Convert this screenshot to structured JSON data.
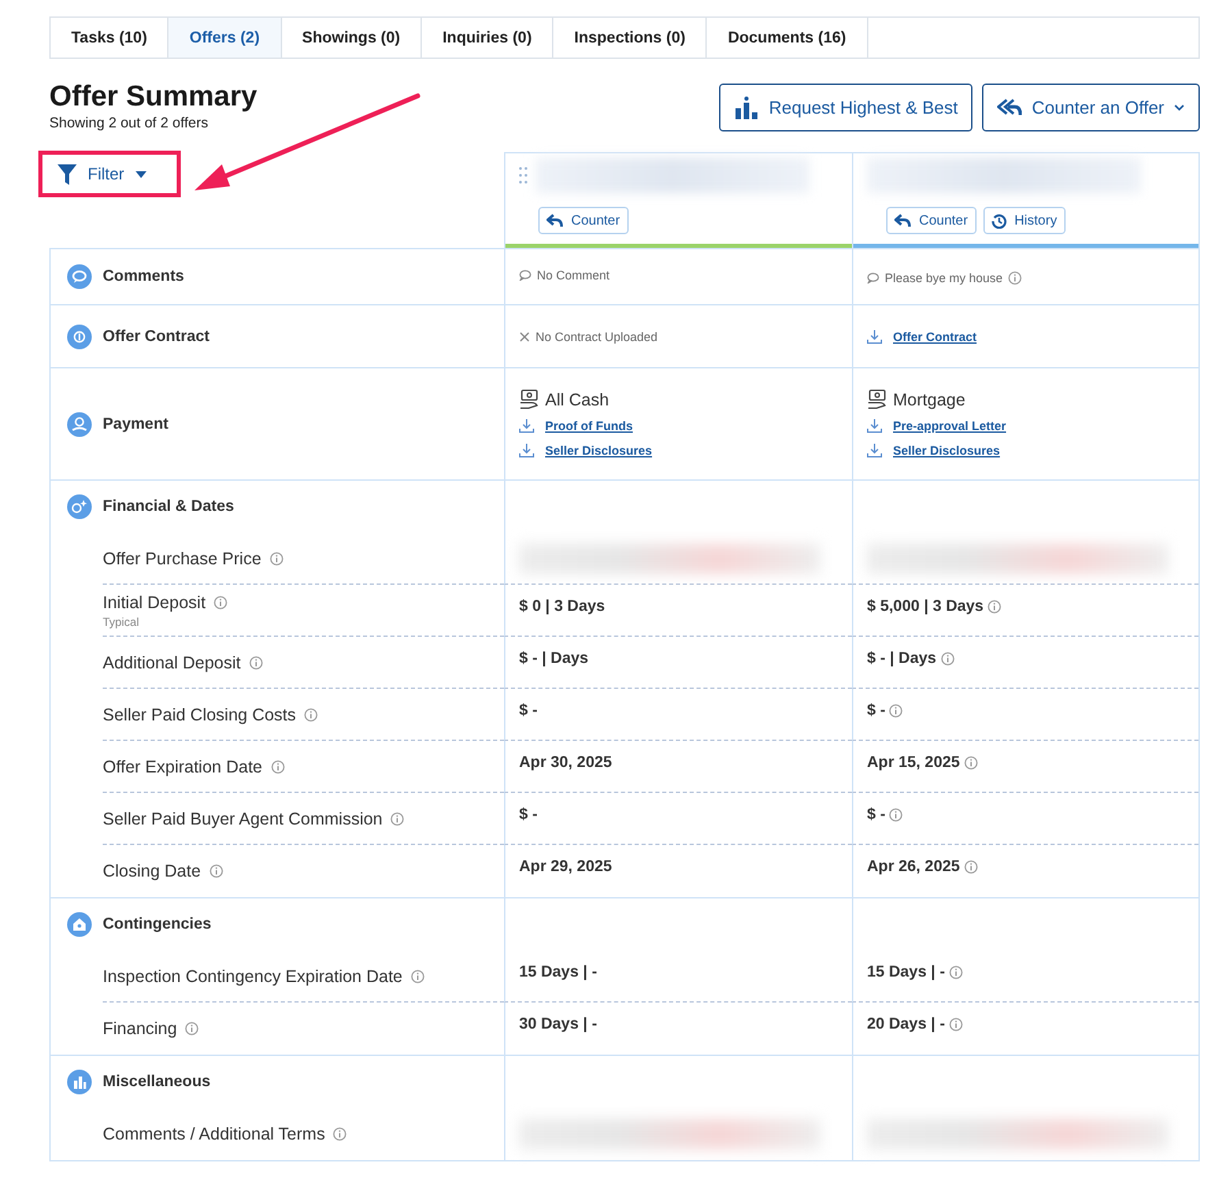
{
  "tabs": [
    {
      "label": "Tasks",
      "count": "(10)",
      "selected": false
    },
    {
      "label": "Offers",
      "count": "(2)",
      "selected": true
    },
    {
      "label": "Showings",
      "count": "(0)",
      "selected": false
    },
    {
      "label": "Inquiries",
      "count": "(0)",
      "selected": false
    },
    {
      "label": "Inspections",
      "count": "(0)",
      "selected": false
    },
    {
      "label": "Documents",
      "count": "(16)",
      "selected": false
    }
  ],
  "title": "Offer Summary",
  "subtitle": "Showing 2 out of 2 offers",
  "actions": [
    {
      "label": "Request Highest & Best",
      "kind": "chart",
      "dropdown": false
    },
    {
      "label": "Counter an Offer",
      "kind": "reply",
      "dropdown": true
    }
  ],
  "filter": {
    "label": "Filter"
  },
  "offers": [
    {
      "color": "#9bd36a",
      "draggable": true,
      "buttons": [
        {
          "label": "Counter",
          "kind": "counter"
        }
      ]
    },
    {
      "color": "#74b6ea",
      "draggable": false,
      "buttons": [
        {
          "label": "Counter",
          "kind": "counter"
        },
        {
          "label": "History",
          "kind": "history"
        }
      ]
    }
  ],
  "sections": [
    {
      "kind": "single",
      "label": "Comments",
      "cells": [
        {
          "kind": "comment",
          "text": "No Comment",
          "info": false
        },
        {
          "kind": "comment",
          "text": "Please bye my house",
          "info": true
        }
      ]
    },
    {
      "kind": "single",
      "label": "Offer Contract",
      "cells": [
        {
          "kind": "missing",
          "text": "No Contract Uploaded"
        },
        {
          "kind": "link",
          "text": "Offer Contract"
        }
      ]
    },
    {
      "kind": "single",
      "label": "Payment",
      "cells": [
        {
          "kind": "payment",
          "method": "All Cash",
          "links": [
            "Proof of Funds",
            "Seller Disclosures"
          ]
        },
        {
          "kind": "payment",
          "method": "Mortgage",
          "links": [
            "Pre-approval Letter",
            "Seller Disclosures"
          ]
        }
      ]
    },
    {
      "kind": "group",
      "title": "Financial & Dates",
      "rows": [
        {
          "label": "Offer Purchase Price",
          "info": true,
          "cells": [
            {
              "kind": "redacted"
            },
            {
              "kind": "redacted"
            }
          ]
        },
        {
          "label": "Initial Deposit",
          "info": true,
          "note": "Typical",
          "cells": [
            {
              "kind": "value",
              "text": "$ 0 | 3 Days",
              "info": false
            },
            {
              "kind": "value",
              "text": "$ 5,000 | 3 Days",
              "info": true
            }
          ]
        },
        {
          "label": "Additional Deposit",
          "info": true,
          "cells": [
            {
              "kind": "value",
              "text": "$ - | Days",
              "info": false
            },
            {
              "kind": "value",
              "text": "$ - | Days",
              "info": true
            }
          ]
        },
        {
          "label": "Seller Paid Closing Costs",
          "info": true,
          "cells": [
            {
              "kind": "value",
              "text": "$ -",
              "info": false
            },
            {
              "kind": "value",
              "text": "$ -",
              "info": true
            }
          ]
        },
        {
          "label": "Offer Expiration Date",
          "info": true,
          "cells": [
            {
              "kind": "value",
              "text": "Apr 30, 2025",
              "info": false
            },
            {
              "kind": "value",
              "text": "Apr 15, 2025",
              "info": true
            }
          ]
        },
        {
          "label": "Seller Paid Buyer Agent Commission",
          "info": true,
          "cells": [
            {
              "kind": "value",
              "text": "$ -",
              "info": false
            },
            {
              "kind": "value",
              "text": "$ -",
              "info": true
            }
          ]
        },
        {
          "label": "Closing Date",
          "info": true,
          "cells": [
            {
              "kind": "value",
              "text": "Apr 29, 2025",
              "info": false
            },
            {
              "kind": "value",
              "text": "Apr 26, 2025",
              "info": true
            }
          ]
        }
      ]
    },
    {
      "kind": "group",
      "title": "Contingencies",
      "rows": [
        {
          "label": "Inspection Contingency Expiration Date",
          "info": true,
          "cells": [
            {
              "kind": "value",
              "text": "15 Days | -",
              "info": false
            },
            {
              "kind": "value",
              "text": "15 Days | -",
              "info": true
            }
          ]
        },
        {
          "label": "Financing",
          "info": true,
          "cells": [
            {
              "kind": "value",
              "text": "30 Days | -",
              "info": false
            },
            {
              "kind": "value",
              "text": "20 Days | -",
              "info": true
            }
          ]
        }
      ]
    },
    {
      "kind": "group",
      "title": "Miscellaneous",
      "rows": [
        {
          "label": "Comments / Additional Terms",
          "info": true,
          "cells": [
            {
              "kind": "redacted"
            },
            {
              "kind": "redacted"
            }
          ]
        }
      ]
    }
  ]
}
